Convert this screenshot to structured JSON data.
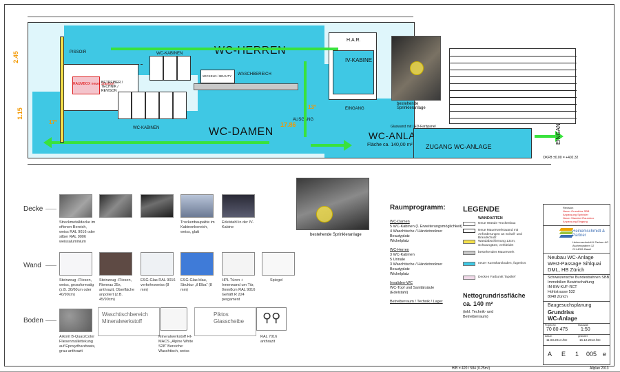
{
  "plan": {
    "wc_herren": "WC-HERREN",
    "wc_damen": "WC-DAMEN",
    "wc_anlage": "WC-ANLAGE",
    "flaeche": "Fläche ca. 140,00 m²",
    "zugang": "ZUGANG WC-ANLAGE",
    "pissoir": "PISSOIR",
    "wc_kabinen_top": "WC-KABINEN",
    "wc_kabinen_bottom": "WC-KABINEN",
    "waschbereich": "WASCHBEREICH",
    "wickeln": "WICKELN / BEAUTY",
    "betreiber": "BETREIBER / TECHNIK / REVISON",
    "raumbox": "RAUMBOX neuer Standort",
    "har": "H.A.R.",
    "ivkabine": "IV-KABINE",
    "eingang": "EINGANG",
    "ausgang": "AUSGANG",
    "glaswand": "Glaswand mit LED-Farbpanel",
    "dim_245": "2.45",
    "dim_15": "1.15",
    "dim_17": "17°",
    "dim_1786": "17.86",
    "dim_13": "13°",
    "eingang_side": "EINGANG WC-ANLAGE",
    "okfb": "OKFB ±0.00 = +402.32",
    "sprinkler_top": "bestehende Sprinkleranlage",
    "sprinkler_bottom": "bestehende Sprinkleranlage"
  },
  "materials": {
    "rows": [
      "Decke",
      "Wand",
      "Boden"
    ],
    "decke": [
      {
        "color": "#7a7a7a",
        "text": "Streckmetalldecke im offenen Bereich, weiss RAL 9016 oder silber RAL 9006 weissaluminium"
      },
      {
        "color": "#5a5a5a",
        "text": ""
      },
      {
        "color": "#3a3a3a",
        "text": ""
      },
      {
        "color": "#8f9bb0",
        "text": "Trockenbaupaltte im Kabinenbereich, weiss, glatt"
      },
      {
        "color": "#3c3c48",
        "text": "Edelstahl in der IV-Kabine"
      }
    ],
    "wand": [
      {
        "color": "#f6f6f8",
        "text": "Steinzeug -Fliesen, weiss, grossformatig (z.B. 30/60cm oder 40/90cm)"
      },
      {
        "color": "#5e4a44",
        "text": "Steinzeug -Fliesen, Rieneas 35x, anthrazit, Oberfläche anpoliert (z.B. 45/90cm)"
      },
      {
        "color": "#eef1f4",
        "text": "ESG-Glas RAL 9016 verkehrsweiss (8 mm)"
      },
      {
        "color": "#3f7bd8",
        "text": "ESG-Glas blau, Struktur „il Elba“ (8 mm)"
      },
      {
        "color": "#f4f4f4",
        "text": "HPL Türen + Innenwand um Tür, 0mm8cm RAL 9016 Gehäft R 224 pergament"
      },
      {
        "color": "#f8f8f8",
        "text": "Spiegel"
      }
    ],
    "boden": [
      {
        "color": "#8a8a8a",
        "text": "Arkorit B-QuarzColor Fliesenmallettekung auf Epoxydharzbasis, grau-anthrazit"
      },
      {
        "color": "#ffffff",
        "text": "Waschtischbereich Mineralwerkstoff"
      },
      {
        "color": "#f6f6f6",
        "text": "Mineralwerkstoff HI-MACS „Alpine White S28“ Bereiche: Waschtisch, weiss"
      },
      {
        "color": "#ffffff",
        "text": "Piktos Glasscheibe"
      },
      {
        "color": "#ffffff",
        "text": "RAL 7016 anthrazit"
      }
    ]
  },
  "raumprogramm": {
    "title": "Raumprogramm:",
    "sections": [
      {
        "head": "WC-Damen",
        "lines": [
          "5 WC-Kabinen (1 Erweiterungsmöglichkeit)",
          "4 Waschtische / Händetrockner",
          "Beautyplatz",
          "Wickelplatz"
        ]
      },
      {
        "head": "WC-Herren",
        "lines": [
          "3 WC-Kabinen",
          "5 Urinale",
          "3 Waschtische / Händetrockner",
          "Beautyplatz",
          "Wickelplatz"
        ]
      },
      {
        "head": "Invaliden-WC",
        "lines": [
          "WC-Topf und Sanitärsäule",
          "(Edelstahl)"
        ]
      },
      {
        "head": "Betreiberraum / Technik / Lager",
        "lines": []
      }
    ]
  },
  "legende": {
    "title": "LEGENDE",
    "subtitle": "WANDARTEN",
    "items": [
      {
        "color": "#ffffff",
        "text": "Neue Wände Trockenbau"
      },
      {
        "color": "#ffffff",
        "text": "Neue Mauerwerkswand mit Anforderungen an Schall- und Brandschutz"
      },
      {
        "color": "#f4e04a",
        "text": "Wandabschirmung 13cm, Schwungtüre, verkleidet"
      },
      {
        "color": "#c8c8c8",
        "text": "bestehendes Mauerwerk"
      },
      {
        "color": "#3fc8e4",
        "text": "neuer Kunstharzboden, fugenlos"
      },
      {
        "color": "#f0d8e8",
        "text": "Decken Farbunkt Tapölief"
      }
    ],
    "netto_title": "Nettogrundrissfläche",
    "netto_value": "ca. 140 m²",
    "netto_note": "(inkl. Technik- und Betreiberraum)"
  },
  "titleblock": {
    "firm_name": "Heinemschmidt & Partner",
    "firm_lines": [
      "Heinemschmidt & Partner AG",
      "Aschengraben 12",
      "CH-4051 Basel"
    ],
    "project": [
      "Neubau WC-Anlage",
      "West-Passage Sihlquai",
      "DML, HB Zürich"
    ],
    "client": [
      "Schweizerische Bundesbahnen SBB",
      "Immobilien Bewirtschaftung",
      "IM-BW-KUF-RCT",
      "Hohlstrasse 532",
      "8048 Zürich"
    ],
    "phase": "Baugesuchsplanung",
    "plan_type": "Grundriss",
    "plan_name": "WC-Anlage",
    "projekt_nr_label": "Projekt-Nr.",
    "projekt_nr": "70 80 475",
    "massstab_label": "Massstab",
    "massstab": "1:50",
    "datum_label": "Datum",
    "datum": "11.03.2014 /De",
    "geaendert_label": "geändert",
    "geaendert": "16.12.2013 /De",
    "code": [
      "A",
      "E",
      "1",
      "005",
      "e"
    ],
    "revisions": [
      "Revision",
      "Neuer Grundriss SBB",
      "Anpassung Sprinkler",
      "Neuer Standort Raumbox",
      "Anpassung Eingang",
      "Anpassung Tür"
    ]
  },
  "footer": {
    "size": "H/B = 420 / 584 (0.25m²)",
    "cad": "Allplan 2013"
  }
}
